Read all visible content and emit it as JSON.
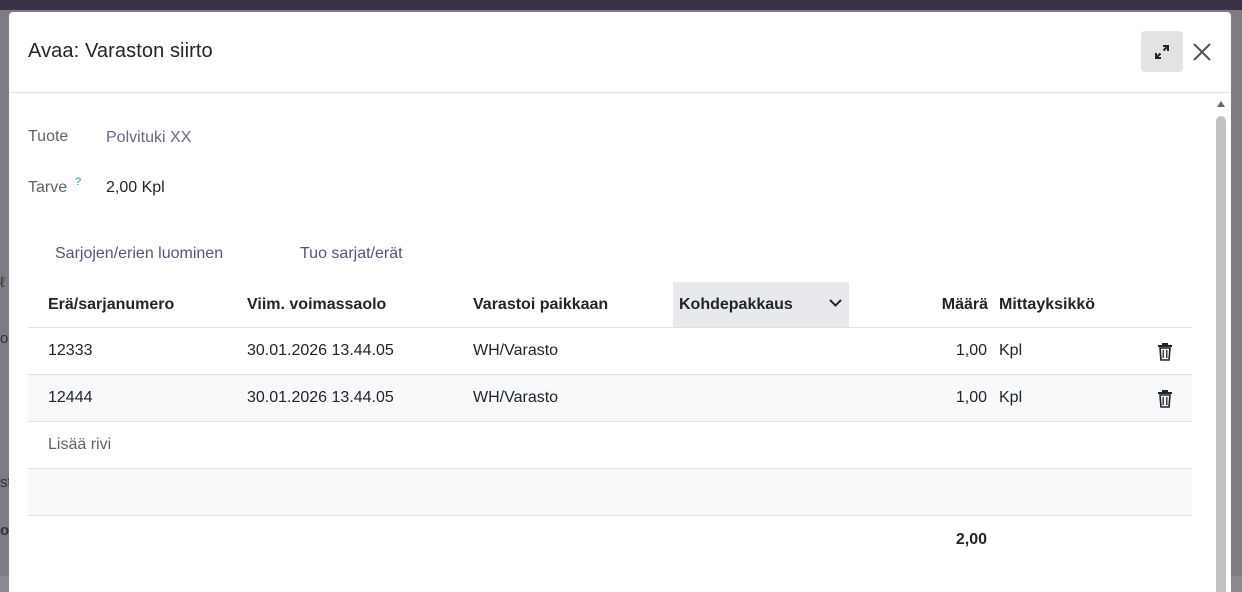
{
  "background": {
    "fragments": [
      "ℓ",
      "o",
      "st",
      "o"
    ]
  },
  "dialog": {
    "title": "Avaa: Varaston siirto",
    "expand_icon": "expand-icon",
    "close_icon": "close-icon"
  },
  "fields": {
    "product_label": "Tuote",
    "product_value": "Polvituki XX",
    "demand_label": "Tarve",
    "demand_help": "?",
    "demand_value": "2,00 Kpl"
  },
  "actions": {
    "generate": "Sarjojen/erien luominen",
    "import": "Tuo sarjat/erät"
  },
  "table": {
    "columns": {
      "lot": "Erä/sarjanumero",
      "expiry": "Viim. voimassaolo",
      "location": "Varastoi paikkaan",
      "package": "Kohdepakkaus",
      "quantity": "Määrä",
      "uom": "Mittayksikkö"
    },
    "rows": [
      {
        "lot": "12333",
        "expiry": "30.01.2026 13.44.05",
        "location": "WH/Varasto",
        "package": "",
        "quantity": "1,00",
        "uom": "Kpl"
      },
      {
        "lot": "12444",
        "expiry": "30.01.2026 13.44.05",
        "location": "WH/Varasto",
        "package": "",
        "quantity": "1,00",
        "uom": "Kpl"
      }
    ],
    "add_line": "Lisää rivi",
    "total": "2,00"
  },
  "colors": {
    "accent": "#5c5179",
    "header_bar": "#3b3147"
  }
}
